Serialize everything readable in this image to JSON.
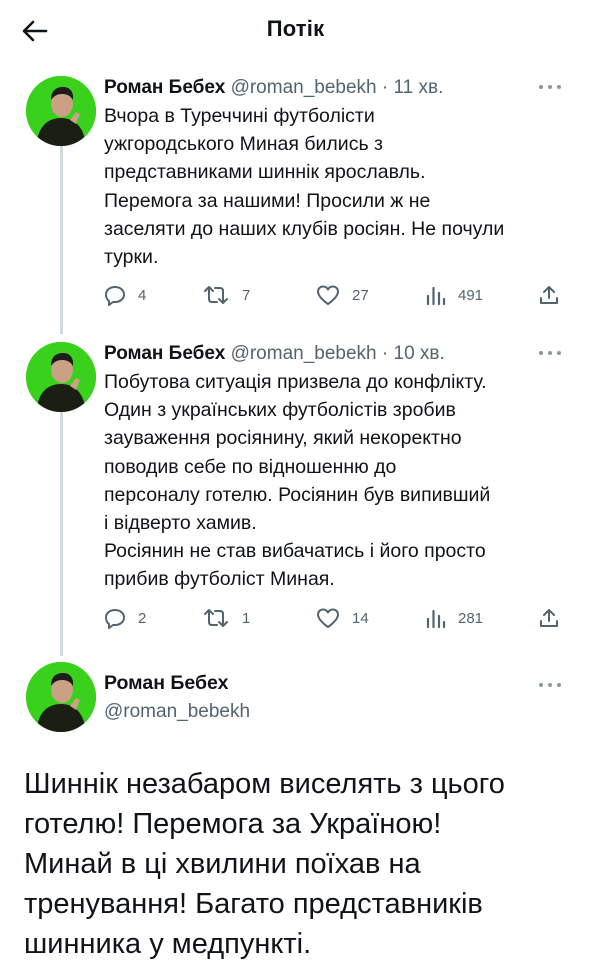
{
  "header": {
    "title": "Потік"
  },
  "tweets": [
    {
      "author_name": "Роман Бебех",
      "handle": "@roman_bebekh",
      "separator": "·",
      "time": "11 хв.",
      "text": "Вчора в Туреччині футболісти\nужгородського Миная бились з\nпредставниками шиннік ярославль.\nПеремога за нашими! Просили ж не\nзаселяти до наших клубів росіян. Не почули\nтурки.",
      "replies": "4",
      "retweets": "7",
      "likes": "27",
      "views": "491"
    },
    {
      "author_name": "Роман Бебех",
      "handle": "@roman_bebekh",
      "separator": "·",
      "time": "10 хв.",
      "text": "Побутова ситуація призвела до конфлікту.\nОдин з українських футболістів зробив\nзауваження росіянину, який некоректно\nповодив себе по відношенню до\nперсоналу готелю. Росіянин був випивший\nі відверто хамив.\nРосіянин не став вибачатись і його просто\nприбив футболіст Миная.",
      "replies": "2",
      "retweets": "1",
      "likes": "14",
      "views": "281"
    }
  ],
  "main_tweet": {
    "author_name": "Роман Бебех",
    "handle": "@roman_bebekh",
    "text": "Шиннік незабаром виселять з цього\nготелю! Перемога за Україною!\nМинай в ці хвилини поїхав на\nтренування! Багато представників\nшинника у медпункті."
  },
  "icons": {
    "back": "arrow-left-icon",
    "more": "more-horizontal-icon",
    "reply": "reply-icon",
    "retweet": "retweet-icon",
    "like": "heart-icon",
    "views": "analytics-icon",
    "share": "share-icon"
  },
  "colors": {
    "avatar_background": "#3ad11c",
    "secondary_text": "#536471",
    "thread_line": "#cfd9de"
  }
}
